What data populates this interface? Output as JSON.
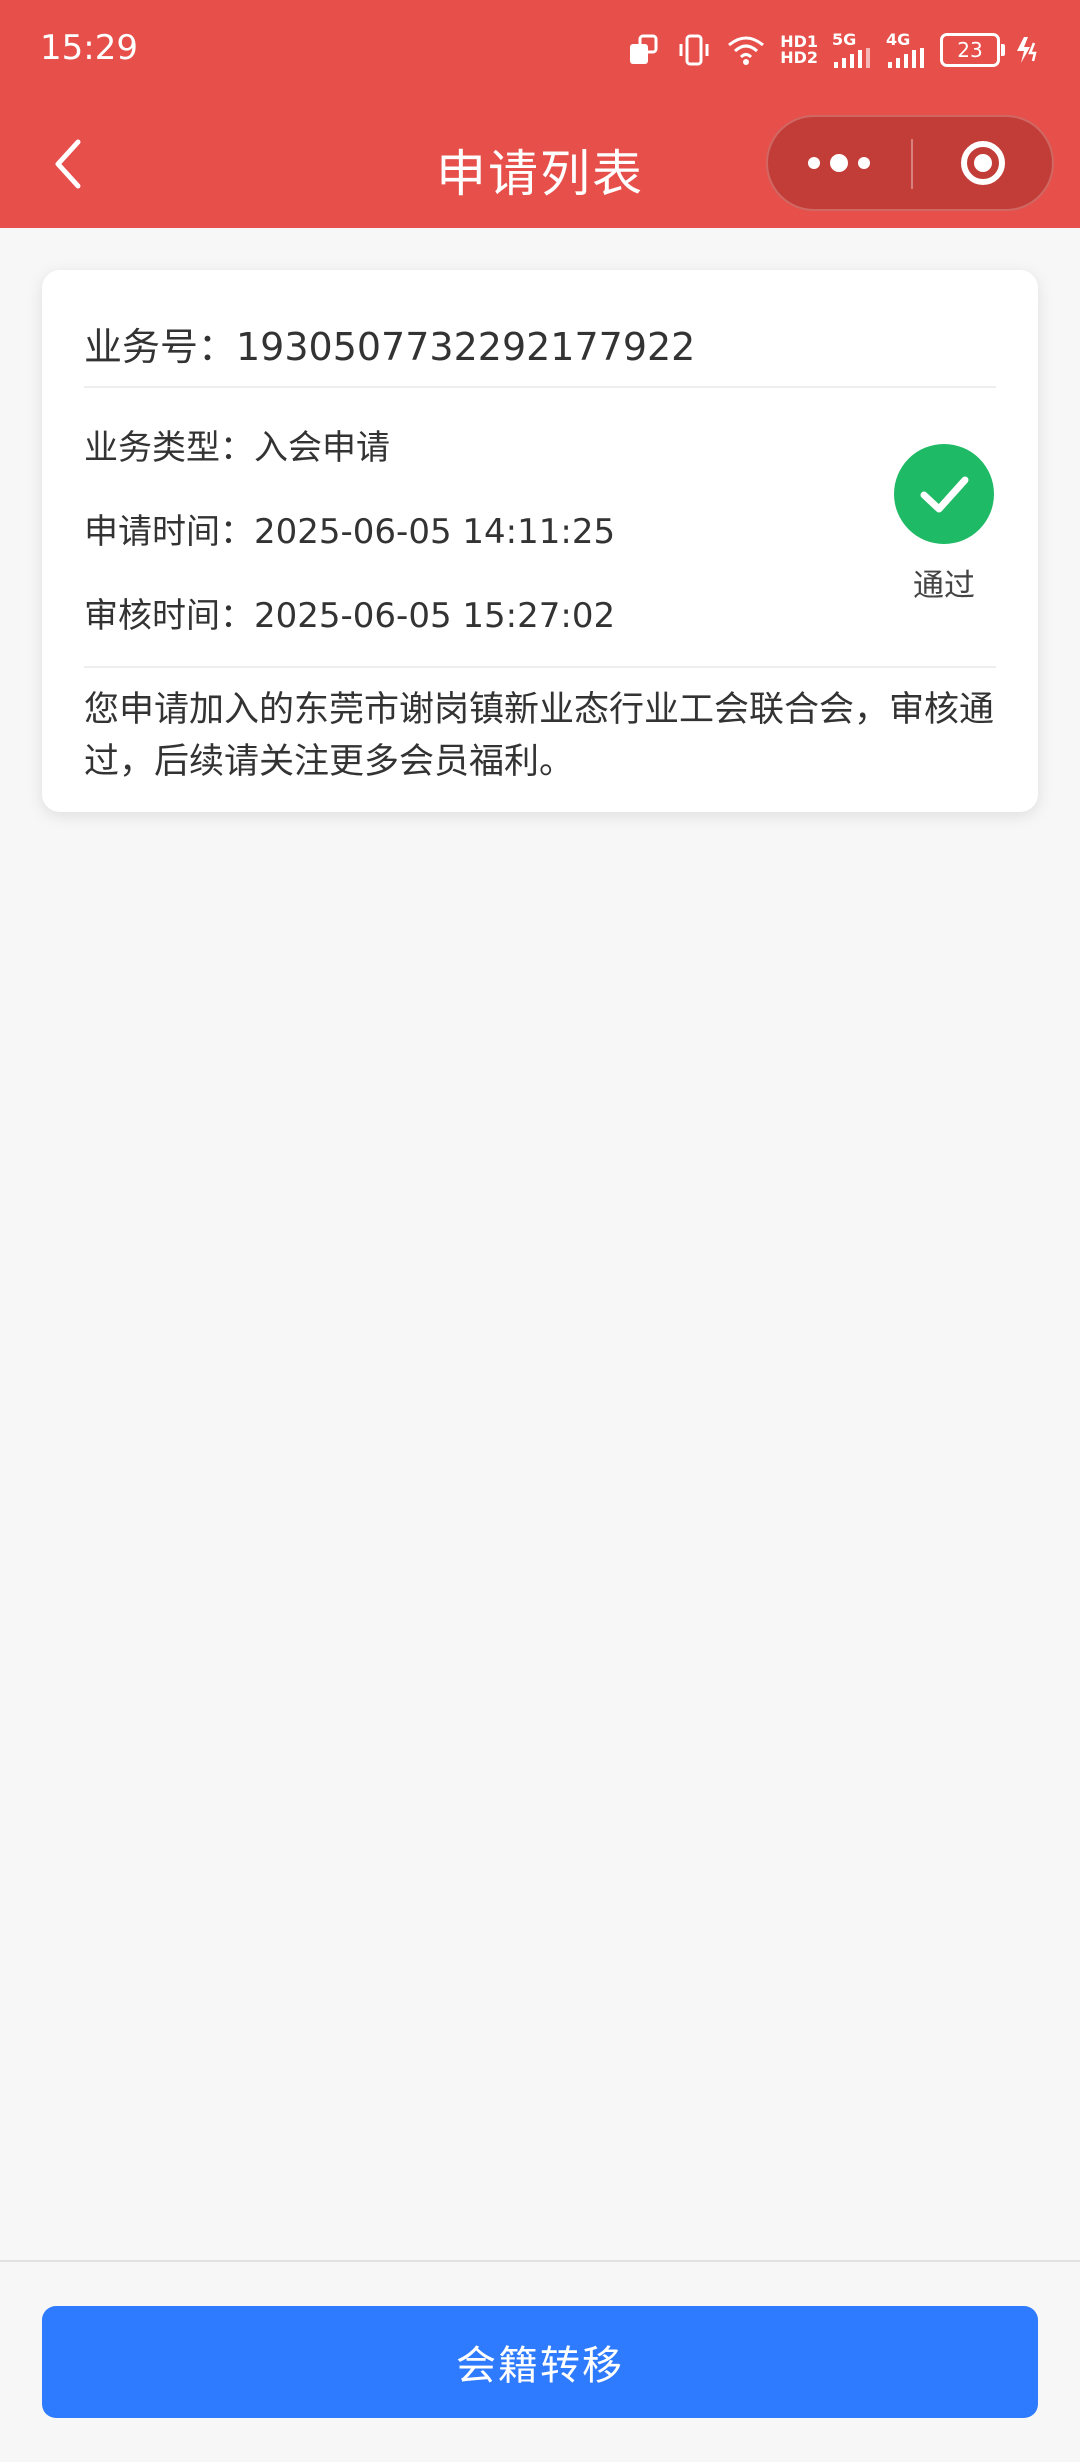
{
  "status_bar": {
    "time": "15:29",
    "hd1": "HD1",
    "hd2": "HD2",
    "net1": "5G",
    "net2": "4G",
    "battery": "23",
    "icons": [
      "rotation-lock-icon",
      "vibrate-icon",
      "wifi-icon",
      "signal-icon",
      "signal-icon",
      "battery-icon",
      "charging-icon"
    ]
  },
  "nav": {
    "title": "申请列表",
    "back_icon": "chevron-left-icon",
    "more_icon": "more-dots-icon",
    "close_icon": "target-close-icon"
  },
  "record": {
    "business_no": "业务号：1930507732292177922",
    "type_line": "业务类型：入会申请",
    "apply_time_line": "申请时间：2025-06-05 14:11:25",
    "review_time_line": "审核时间：2025-06-05 15:27:02",
    "status": "通过",
    "status_icon": "check-circle-icon",
    "message": "您申请加入的东莞市谢岗镇新业态行业工会联合会，审核通过，后续请关注更多会员福利。"
  },
  "footer": {
    "button_label": "会籍转移"
  },
  "colors": {
    "header": "#e74f4a",
    "capsule": "#c33d38",
    "success": "#1fba65",
    "primary_button": "#2f7bff",
    "background": "#f7f7f7"
  }
}
